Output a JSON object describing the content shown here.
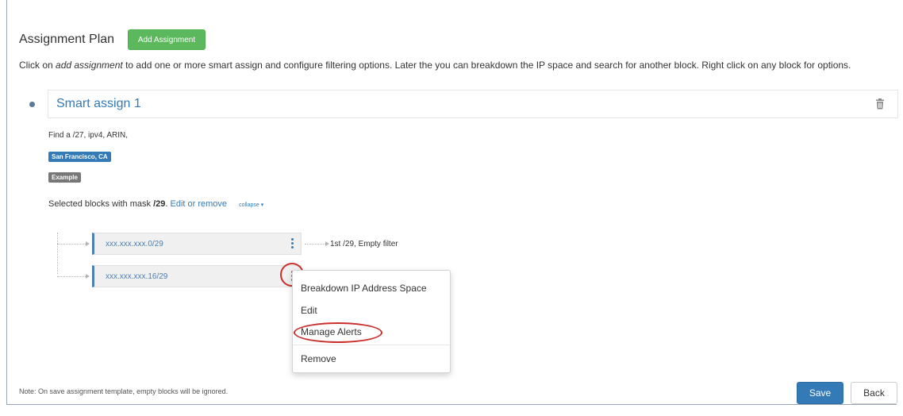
{
  "header": {
    "title": "Assignment Plan",
    "add_button": "Add Assignment"
  },
  "intro": {
    "prefix": "Click on ",
    "emphasis": "add assignment",
    "suffix": " to add one or more smart assign and configure filtering options. Later the you can breakdown the IP space and search for another block. Right click on any block for options."
  },
  "smart_assign": {
    "title": "Smart assign 1",
    "find_text": "Find a /27, ipv4, ARIN,",
    "labels": [
      "San Francisco, CA",
      "Example"
    ],
    "selected_prefix": "Selected blocks with mask ",
    "mask": "/29",
    "selected_suffix": ".",
    "edit_link": "Edit or remove",
    "collapse_link": "collapse ▾"
  },
  "blocks": [
    {
      "text": "xxx.xxx.xxx.0/29"
    },
    {
      "text": "xxx.xxx.xxx.16/29"
    }
  ],
  "result_text": "1st /29,   Empty filter",
  "context_menu": {
    "items": [
      "Breakdown IP Address Space",
      "Edit",
      "Manage Alerts",
      "Remove"
    ]
  },
  "footer": {
    "note": "Note: On save assignment template, empty blocks will be ignored.",
    "save_label": "Save",
    "back_label": "Back"
  },
  "colors": {
    "primary": "#337ab7",
    "success": "#5cb85c",
    "annotation": "#c9302c"
  }
}
